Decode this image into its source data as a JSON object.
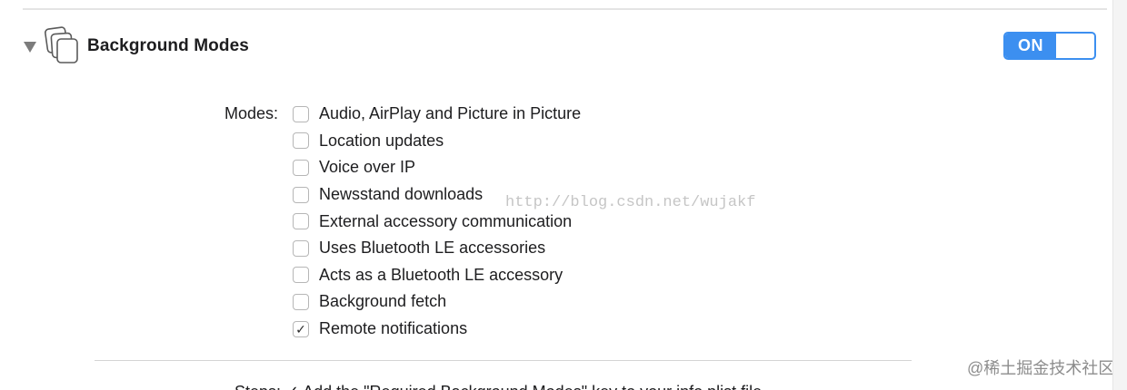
{
  "section": {
    "title": "Background Modes",
    "toggle_label": "ON",
    "toggle_state": "on",
    "accent_color": "#3C8FF0",
    "icon": "stacked-windows-icon"
  },
  "modes": {
    "label": "Modes:",
    "items": [
      {
        "label": "Audio, AirPlay and Picture in Picture",
        "checked": false,
        "mark": ""
      },
      {
        "label": "Location updates",
        "checked": false,
        "mark": ""
      },
      {
        "label": "Voice over IP",
        "checked": false,
        "mark": ""
      },
      {
        "label": "Newsstand downloads",
        "checked": false,
        "mark": ""
      },
      {
        "label": "External accessory communication",
        "checked": false,
        "mark": ""
      },
      {
        "label": "Uses Bluetooth LE accessories",
        "checked": false,
        "mark": ""
      },
      {
        "label": "Acts as a Bluetooth LE accessory",
        "checked": false,
        "mark": ""
      },
      {
        "label": "Background fetch",
        "checked": false,
        "mark": ""
      },
      {
        "label": "Remote notifications",
        "checked": true,
        "mark": "✓"
      }
    ]
  },
  "steps_cutoff": "Steps: ✓ Add the \"Required Background Modes\" key to your info plist file",
  "watermark": "http://blog.csdn.net/wujakf",
  "credit": "@稀土掘金技术社区"
}
